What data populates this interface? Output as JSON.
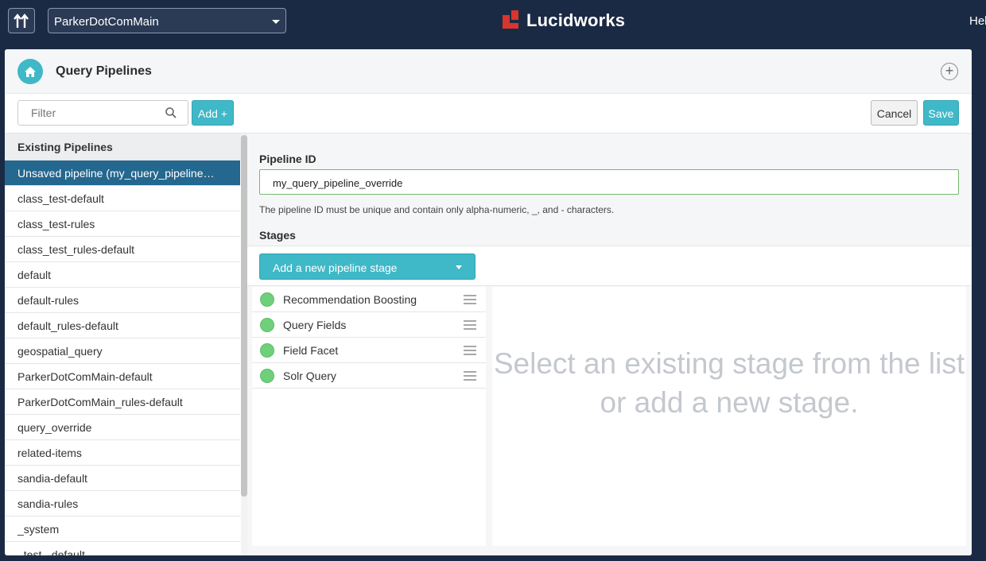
{
  "topbar": {
    "app_name": "ParkerDotComMain",
    "brand": "Lucidworks",
    "help_label": "Help"
  },
  "header": {
    "title": "Query Pipelines",
    "home_icon": "home-icon",
    "add_icon": "plus-circle-icon"
  },
  "toolbar": {
    "filter_placeholder": "Filter",
    "add_label": "Add +",
    "cancel_label": "Cancel",
    "save_label": "Save"
  },
  "sidebar": {
    "heading": "Existing Pipelines",
    "items": [
      {
        "label": "Unsaved pipeline (my_query_pipeline…"
      },
      {
        "label": "class_test-default"
      },
      {
        "label": "class_test-rules"
      },
      {
        "label": "class_test_rules-default"
      },
      {
        "label": "default"
      },
      {
        "label": "default-rules"
      },
      {
        "label": "default_rules-default"
      },
      {
        "label": "geospatial_query"
      },
      {
        "label": "ParkerDotComMain-default"
      },
      {
        "label": "ParkerDotComMain_rules-default"
      },
      {
        "label": "query_override"
      },
      {
        "label": "related-items"
      },
      {
        "label": "sandia-default"
      },
      {
        "label": "sandia-rules"
      },
      {
        "label": "_system"
      },
      {
        "label": "_test_-default"
      }
    ]
  },
  "main": {
    "pipeline_id_label": "Pipeline ID",
    "pipeline_id_value": "my_query_pipeline_override",
    "help_text": "The pipeline ID must be unique and contain only alpha-numeric, _, and - characters.",
    "stages_label": "Stages",
    "add_stage_label": "Add a new pipeline stage",
    "stages": [
      {
        "name": "Recommendation Boosting"
      },
      {
        "name": "Query Fields"
      },
      {
        "name": "Field Facet"
      },
      {
        "name": "Solr Query"
      }
    ],
    "placeholder": "Select an existing stage from the list or add a new stage."
  },
  "colors": {
    "navbar": "#1b2a44",
    "accent": "#3fb8c7",
    "selected": "#24678f",
    "stage_dot": "#6fd07c"
  }
}
